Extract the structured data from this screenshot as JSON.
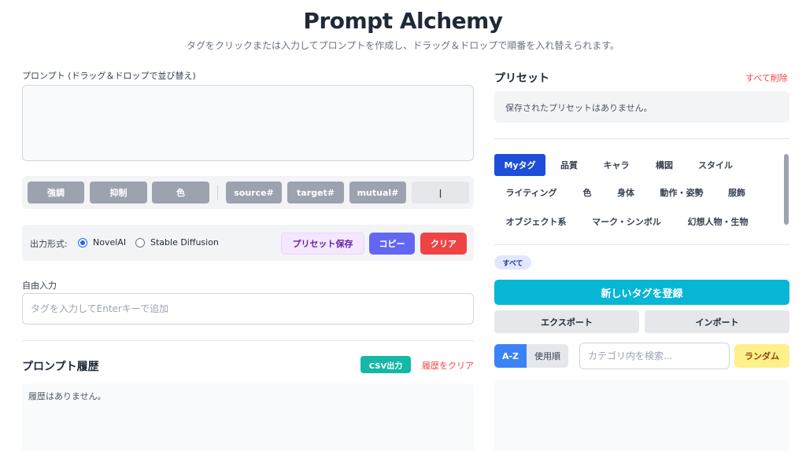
{
  "header": {
    "title": "Prompt Alchemy",
    "subtitle": "タグをクリックまたは入力してプロンプトを作成し、ドラッグ＆ドロップで順番を入れ替えられます。"
  },
  "prompt": {
    "label": "プロンプト (ドラッグ＆ドロップで並び替え)",
    "value": ""
  },
  "toolbar": {
    "emphasis": "強調",
    "suppress": "抑制",
    "color": "色",
    "source": "source#",
    "target": "target#",
    "mutual": "mutual#",
    "pipe": "|"
  },
  "format": {
    "label": "出力形式:",
    "options": [
      "NovelAI",
      "Stable Diffusion"
    ],
    "selected": "NovelAI",
    "save_preset": "プリセット保存",
    "copy": "コピー",
    "clear": "クリア"
  },
  "free_input": {
    "label": "自由入力",
    "placeholder": "タグを入力してEnterキーで追加"
  },
  "history": {
    "title": "プロンプト履歴",
    "csv": "CSV出力",
    "clear": "履歴をクリア",
    "empty": "履歴はありません。"
  },
  "presets": {
    "title": "プリセット",
    "delete_all": "すべて削除",
    "empty": "保存されたプリセットはありません。"
  },
  "categories": {
    "tabs": [
      "Myタグ",
      "品質",
      "キャラ",
      "構図",
      "スタイル",
      "ライティング",
      "色",
      "身体",
      "動作・姿勢",
      "服飾",
      "オブジェクト系",
      "マーク・シンボル",
      "幻想人物・生物"
    ],
    "active": "Myタグ",
    "filter_all": "すべて"
  },
  "tag_actions": {
    "new_tag": "新しいタグを登録",
    "export": "エクスポート",
    "import": "インポート"
  },
  "sort": {
    "az": "A-Z",
    "usage": "使用順",
    "search_placeholder": "カテゴリ内を検索...",
    "random": "ランダム"
  },
  "colors": {
    "accent_blue": "#1d4ed8",
    "copy": "#6366f1",
    "clear": "#ef4444",
    "csv": "#14b8a6",
    "new_tag": "#06b6d4",
    "random": "#fef08a"
  }
}
